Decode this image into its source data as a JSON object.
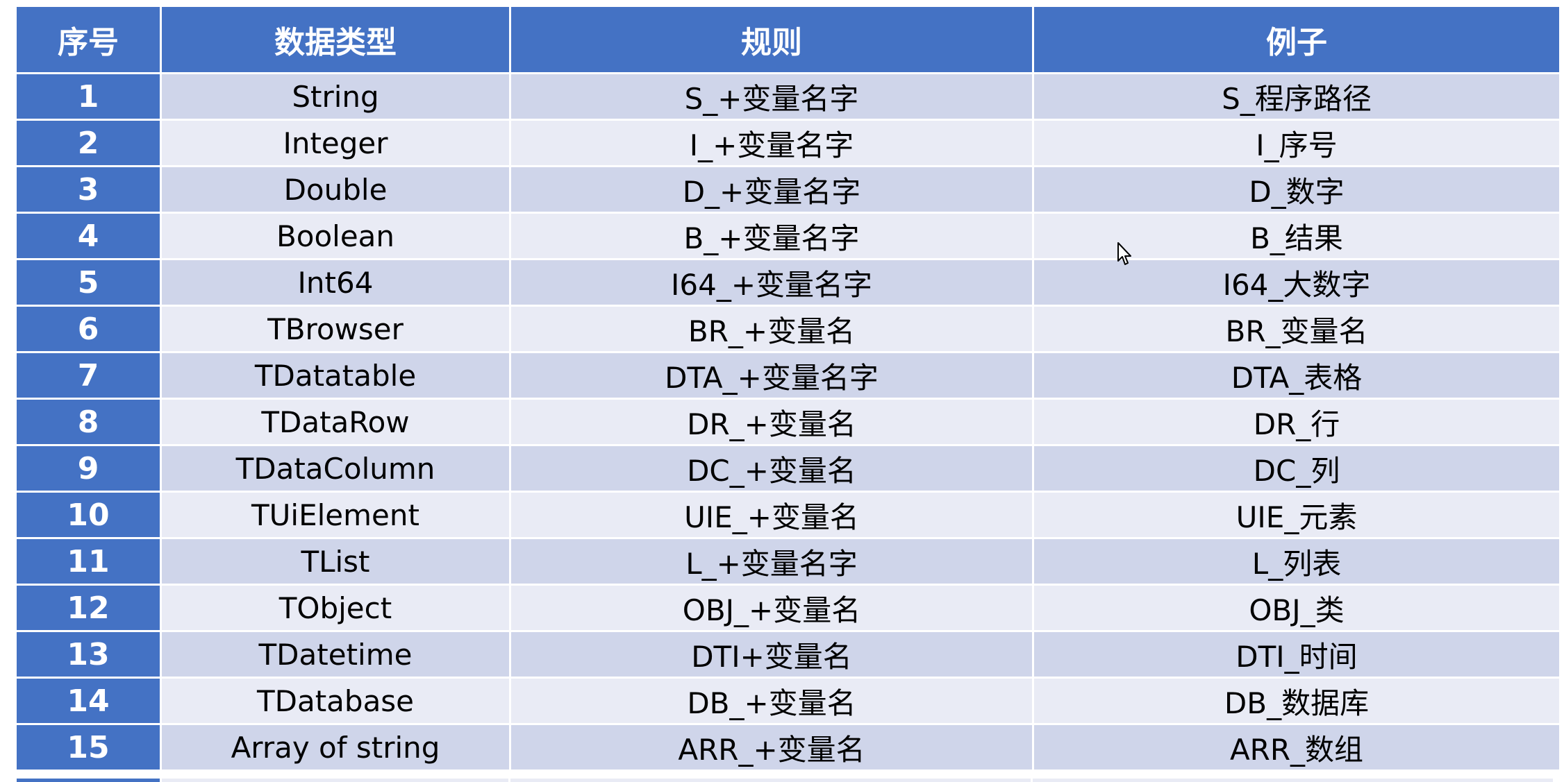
{
  "table": {
    "headers": [
      "序号",
      "数据类型",
      "规则",
      "例子"
    ],
    "rows": [
      {
        "no": "1",
        "type": "String",
        "rule": "S_+变量名字",
        "example": "S_程序路径"
      },
      {
        "no": "2",
        "type": "Integer",
        "rule": "I_+变量名字",
        "example": "I_序号"
      },
      {
        "no": "3",
        "type": "Double",
        "rule": "D_+变量名字",
        "example": "D_数字"
      },
      {
        "no": "4",
        "type": "Boolean",
        "rule": "B_+变量名字",
        "example": "B_结果"
      },
      {
        "no": "5",
        "type": "Int64",
        "rule": "I64_+变量名字",
        "example": "I64_大数字"
      },
      {
        "no": "6",
        "type": "TBrowser",
        "rule": "BR_+变量名",
        "example": "BR_变量名"
      },
      {
        "no": "7",
        "type": "TDatatable",
        "rule": "DTA_+变量名字",
        "example": "DTA_表格"
      },
      {
        "no": "8",
        "type": "TDataRow",
        "rule": "DR_+变量名",
        "example": "DR_行"
      },
      {
        "no": "9",
        "type": "TDataColumn",
        "rule": "DC_+变量名",
        "example": "DC_列"
      },
      {
        "no": "10",
        "type": "TUiElement",
        "rule": "UIE_+变量名",
        "example": "UIE_元素"
      },
      {
        "no": "11",
        "type": "TList",
        "rule": "L_+变量名字",
        "example": "L_列表"
      },
      {
        "no": "12",
        "type": "TObject",
        "rule": "OBJ_+变量名",
        "example": "OBJ_类"
      },
      {
        "no": "13",
        "type": "TDatetime",
        "rule": "DTI+变量名",
        "example": "DTI_时间"
      },
      {
        "no": "14",
        "type": "TDatabase",
        "rule": "DB_+变量名",
        "example": "DB_数据库"
      },
      {
        "no": "15",
        "type": "Array of string",
        "rule": "ARR_+变量名",
        "example": "ARR_数组"
      }
    ]
  },
  "colors": {
    "header_bg": "#4472c4",
    "row_odd": "#cfd5ea",
    "row_even": "#e9ebf5"
  }
}
